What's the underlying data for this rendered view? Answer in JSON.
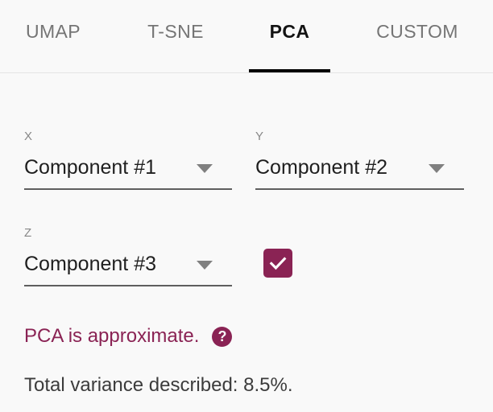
{
  "theme": {
    "background": "#f9f9f9",
    "accent": "#8a2354",
    "active_tab_color": "#131313",
    "inactive_tab_color": "#757575",
    "divider": "#e4e4e4",
    "underline": "#5f5f5f",
    "body_text": "#3c3c3c"
  },
  "tabs": [
    {
      "id": "umap",
      "label": "UMAP",
      "active": false
    },
    {
      "id": "tsne",
      "label": "T-SNE",
      "active": false
    },
    {
      "id": "pca",
      "label": "PCA",
      "active": true
    },
    {
      "id": "custom",
      "label": "CUSTOM",
      "active": false
    }
  ],
  "fields": {
    "x": {
      "label": "X",
      "value": "Component #1",
      "arrow_icon": "chevron-down-icon"
    },
    "y": {
      "label": "Y",
      "value": "Component #2",
      "arrow_icon": "chevron-down-icon"
    },
    "z": {
      "label": "Z",
      "value": "Component #3",
      "arrow_icon": "chevron-down-icon"
    }
  },
  "checkbox": {
    "checked": true,
    "icon": "check-icon"
  },
  "notice": {
    "text": "PCA is approximate.",
    "help_icon": "help-circle-icon",
    "help_glyph": "?"
  },
  "variance": {
    "text": "Total variance described: 8.5%."
  }
}
